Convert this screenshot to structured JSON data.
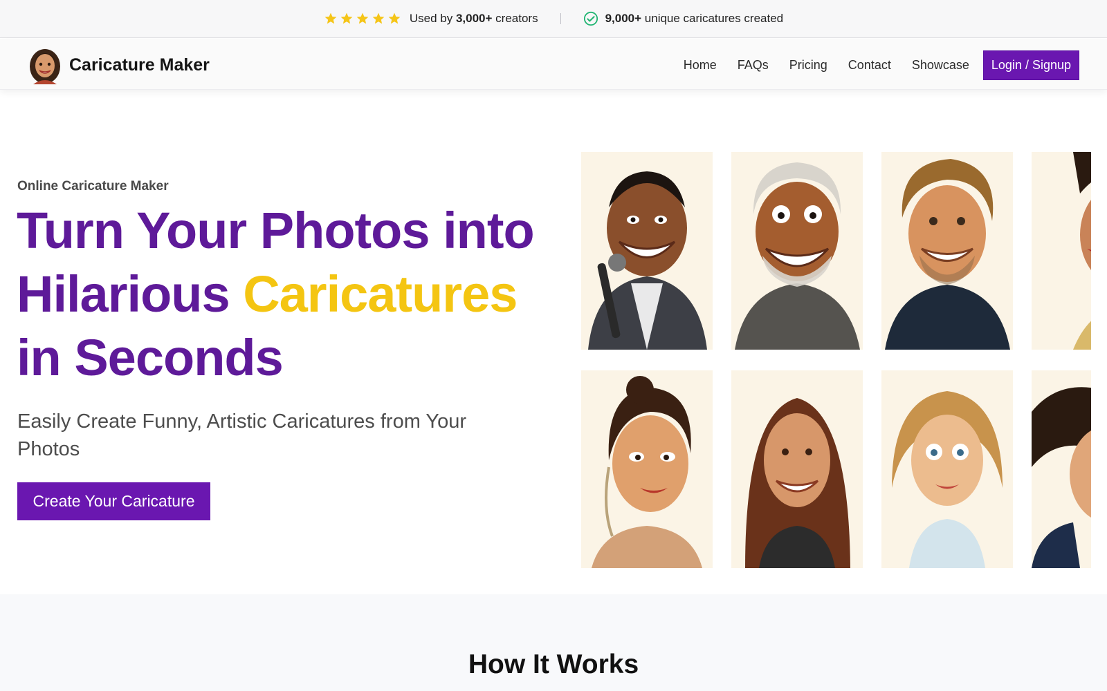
{
  "topbar": {
    "used_prefix": "Used by ",
    "used_count": "3,000+",
    "used_suffix": " creators",
    "created_count": "9,000+",
    "created_suffix": " unique caricatures created",
    "star_color": "#f5c518",
    "check_color": "#22b573"
  },
  "nav": {
    "brand": "Caricature Maker",
    "links": [
      "Home",
      "FAQs",
      "Pricing",
      "Contact",
      "Showcase"
    ],
    "login_label": "Login / Signup"
  },
  "hero": {
    "eyebrow": "Online Caricature Maker",
    "title_line1": "Turn Your Photos into",
    "title_line2_a": "Hilarious ",
    "title_line2_accent": "Caricatures",
    "title_line3": "in Seconds",
    "subtitle": "Easily Create Funny, Artistic Caricatures from Your Photos",
    "cta_label": "Create Your Caricature"
  },
  "section": {
    "how_title": "How It Works"
  },
  "colors": {
    "brand_purple": "#6a17b0",
    "title_purple": "#5e1a99",
    "accent_yellow": "#f4c512"
  }
}
